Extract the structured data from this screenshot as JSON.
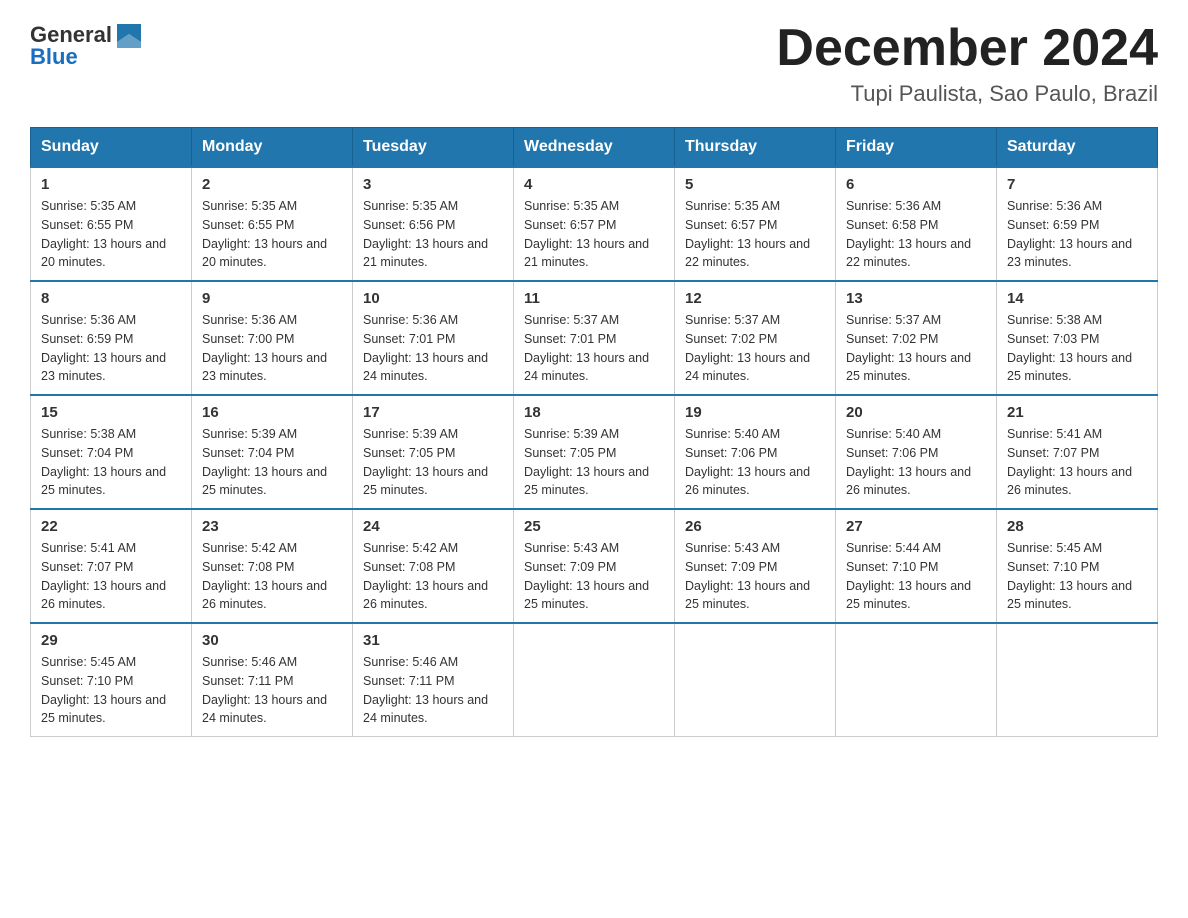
{
  "header": {
    "logo_general": "General",
    "logo_blue": "Blue",
    "month_title": "December 2024",
    "subtitle": "Tupi Paulista, Sao Paulo, Brazil"
  },
  "weekdays": [
    "Sunday",
    "Monday",
    "Tuesday",
    "Wednesday",
    "Thursday",
    "Friday",
    "Saturday"
  ],
  "weeks": [
    [
      {
        "day": "1",
        "sunrise": "5:35 AM",
        "sunset": "6:55 PM",
        "daylight": "13 hours and 20 minutes."
      },
      {
        "day": "2",
        "sunrise": "5:35 AM",
        "sunset": "6:55 PM",
        "daylight": "13 hours and 20 minutes."
      },
      {
        "day": "3",
        "sunrise": "5:35 AM",
        "sunset": "6:56 PM",
        "daylight": "13 hours and 21 minutes."
      },
      {
        "day": "4",
        "sunrise": "5:35 AM",
        "sunset": "6:57 PM",
        "daylight": "13 hours and 21 minutes."
      },
      {
        "day": "5",
        "sunrise": "5:35 AM",
        "sunset": "6:57 PM",
        "daylight": "13 hours and 22 minutes."
      },
      {
        "day": "6",
        "sunrise": "5:36 AM",
        "sunset": "6:58 PM",
        "daylight": "13 hours and 22 minutes."
      },
      {
        "day": "7",
        "sunrise": "5:36 AM",
        "sunset": "6:59 PM",
        "daylight": "13 hours and 23 minutes."
      }
    ],
    [
      {
        "day": "8",
        "sunrise": "5:36 AM",
        "sunset": "6:59 PM",
        "daylight": "13 hours and 23 minutes."
      },
      {
        "day": "9",
        "sunrise": "5:36 AM",
        "sunset": "7:00 PM",
        "daylight": "13 hours and 23 minutes."
      },
      {
        "day": "10",
        "sunrise": "5:36 AM",
        "sunset": "7:01 PM",
        "daylight": "13 hours and 24 minutes."
      },
      {
        "day": "11",
        "sunrise": "5:37 AM",
        "sunset": "7:01 PM",
        "daylight": "13 hours and 24 minutes."
      },
      {
        "day": "12",
        "sunrise": "5:37 AM",
        "sunset": "7:02 PM",
        "daylight": "13 hours and 24 minutes."
      },
      {
        "day": "13",
        "sunrise": "5:37 AM",
        "sunset": "7:02 PM",
        "daylight": "13 hours and 25 minutes."
      },
      {
        "day": "14",
        "sunrise": "5:38 AM",
        "sunset": "7:03 PM",
        "daylight": "13 hours and 25 minutes."
      }
    ],
    [
      {
        "day": "15",
        "sunrise": "5:38 AM",
        "sunset": "7:04 PM",
        "daylight": "13 hours and 25 minutes."
      },
      {
        "day": "16",
        "sunrise": "5:39 AM",
        "sunset": "7:04 PM",
        "daylight": "13 hours and 25 minutes."
      },
      {
        "day": "17",
        "sunrise": "5:39 AM",
        "sunset": "7:05 PM",
        "daylight": "13 hours and 25 minutes."
      },
      {
        "day": "18",
        "sunrise": "5:39 AM",
        "sunset": "7:05 PM",
        "daylight": "13 hours and 25 minutes."
      },
      {
        "day": "19",
        "sunrise": "5:40 AM",
        "sunset": "7:06 PM",
        "daylight": "13 hours and 26 minutes."
      },
      {
        "day": "20",
        "sunrise": "5:40 AM",
        "sunset": "7:06 PM",
        "daylight": "13 hours and 26 minutes."
      },
      {
        "day": "21",
        "sunrise": "5:41 AM",
        "sunset": "7:07 PM",
        "daylight": "13 hours and 26 minutes."
      }
    ],
    [
      {
        "day": "22",
        "sunrise": "5:41 AM",
        "sunset": "7:07 PM",
        "daylight": "13 hours and 26 minutes."
      },
      {
        "day": "23",
        "sunrise": "5:42 AM",
        "sunset": "7:08 PM",
        "daylight": "13 hours and 26 minutes."
      },
      {
        "day": "24",
        "sunrise": "5:42 AM",
        "sunset": "7:08 PM",
        "daylight": "13 hours and 26 minutes."
      },
      {
        "day": "25",
        "sunrise": "5:43 AM",
        "sunset": "7:09 PM",
        "daylight": "13 hours and 25 minutes."
      },
      {
        "day": "26",
        "sunrise": "5:43 AM",
        "sunset": "7:09 PM",
        "daylight": "13 hours and 25 minutes."
      },
      {
        "day": "27",
        "sunrise": "5:44 AM",
        "sunset": "7:10 PM",
        "daylight": "13 hours and 25 minutes."
      },
      {
        "day": "28",
        "sunrise": "5:45 AM",
        "sunset": "7:10 PM",
        "daylight": "13 hours and 25 minutes."
      }
    ],
    [
      {
        "day": "29",
        "sunrise": "5:45 AM",
        "sunset": "7:10 PM",
        "daylight": "13 hours and 25 minutes."
      },
      {
        "day": "30",
        "sunrise": "5:46 AM",
        "sunset": "7:11 PM",
        "daylight": "13 hours and 24 minutes."
      },
      {
        "day": "31",
        "sunrise": "5:46 AM",
        "sunset": "7:11 PM",
        "daylight": "13 hours and 24 minutes."
      },
      null,
      null,
      null,
      null
    ]
  ]
}
